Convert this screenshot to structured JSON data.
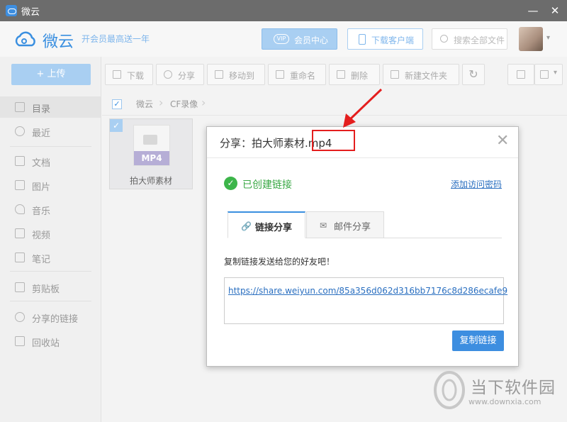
{
  "window": {
    "title": "微云",
    "minimize_glyph": "—",
    "close_glyph": "✕"
  },
  "header": {
    "brand": "微云",
    "slogan": "开会员最高送一年",
    "vip_button": "会员中心",
    "vip_badge": "VIP",
    "download_button": "下载客户端",
    "search_placeholder": "搜索全部文件",
    "avatar_caret": "▾"
  },
  "sidebar": {
    "upload_button": "+ 上传",
    "items": [
      {
        "label": "目录",
        "icon": "list-icon",
        "active": true
      },
      {
        "label": "最近",
        "icon": "clock-icon"
      },
      {
        "label": "文档",
        "icon": "document-icon"
      },
      {
        "label": "图片",
        "icon": "image-icon"
      },
      {
        "label": "音乐",
        "icon": "music-icon"
      },
      {
        "label": "视频",
        "icon": "video-icon"
      },
      {
        "label": "笔记",
        "icon": "note-icon"
      },
      {
        "label": "剪贴板",
        "icon": "clipboard-icon"
      },
      {
        "label": "分享的链接",
        "icon": "link-icon"
      },
      {
        "label": "回收站",
        "icon": "trash-icon"
      }
    ]
  },
  "toolbar": {
    "download": "下载",
    "share": "分享",
    "move": "移动到",
    "rename": "重命名",
    "delete": "删除",
    "new_folder": "新建文件夹",
    "refresh_glyph": "↻",
    "view_glyph": "▾"
  },
  "breadcrumb": {
    "check": "✓",
    "items": [
      "微云",
      "CF录像"
    ],
    "sep": "›"
  },
  "file": {
    "name": "拍大师素材",
    "type_tag": "MP4",
    "check": "✓"
  },
  "dialog": {
    "title": "分享：拍大师素材.mp4",
    "close_glyph": "✕",
    "status_check": "✓",
    "status": "已创建链接",
    "add_password": "添加访问密码",
    "tabs": [
      {
        "label": "链接分享",
        "icon": "link-icon",
        "glyph": "🔗"
      },
      {
        "label": "邮件分享",
        "icon": "mail-icon",
        "glyph": "✉"
      }
    ],
    "hint": "复制链接发送给您的好友吧！",
    "link": "https://share.weiyun.com/85a356d062d316bb7176c8d286ecafe9",
    "copy_button": "复制链接"
  },
  "watermark": {
    "title": "当下软件园",
    "url": "www.downxia.com"
  }
}
